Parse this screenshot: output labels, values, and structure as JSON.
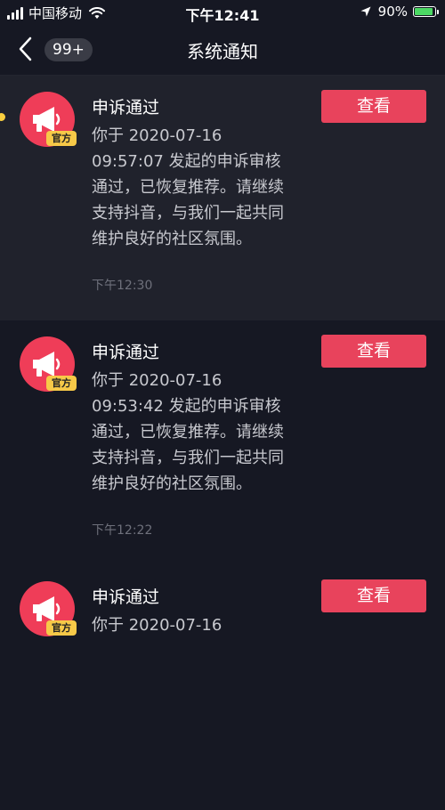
{
  "status_bar": {
    "carrier": "中国移动",
    "time": "下午12:41",
    "battery": "90%",
    "battery_level": 0.9
  },
  "nav": {
    "badge": "99+",
    "title": "系统通知"
  },
  "notifications": [
    {
      "title": "申诉通过",
      "body": "你于 2020-07-16 09:57:07 发起的申诉审核通过，已恢复推荐。请继续支持抖音，与我们一起共同维护良好的社区氛围。",
      "time": "下午12:30",
      "tag": "官方",
      "button": "查看"
    },
    {
      "title": "申诉通过",
      "body": "你于 2020-07-16 09:53:42 发起的申诉审核通过，已恢复推荐。请继续支持抖音，与我们一起共同维护良好的社区氛围。",
      "time": "下午12:22",
      "tag": "官方",
      "button": "查看"
    },
    {
      "title": "申诉通过",
      "body": "你于 2020-07-16",
      "time": "",
      "tag": "官方",
      "button": "查看"
    }
  ]
}
